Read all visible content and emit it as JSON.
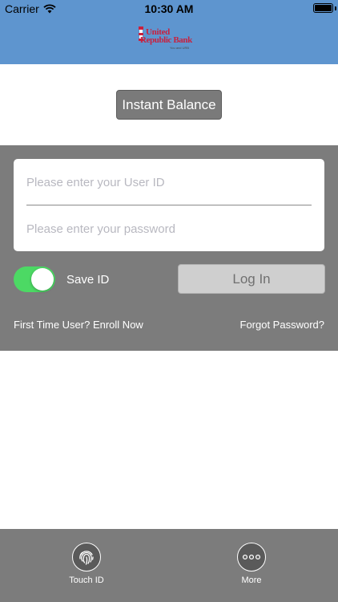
{
  "status_bar": {
    "carrier": "Carrier",
    "time": "10:30 AM",
    "battery_level": 1.0
  },
  "header": {
    "logo": {
      "line1": "United",
      "line2": "Republic Bank",
      "tagline": "You and URB",
      "color": "#c8213f"
    },
    "background": "#5e95cf"
  },
  "instant_balance": {
    "label": "Instant Balance"
  },
  "login": {
    "user_id": {
      "value": "",
      "placeholder": "Please enter your User ID"
    },
    "password": {
      "value": "",
      "placeholder": "Please enter your password"
    },
    "save_id": {
      "label": "Save ID",
      "on": true,
      "on_color": "#4cd964"
    },
    "login_label": "Log In",
    "enroll_label": "First Time User? Enroll Now",
    "forgot_label": "Forgot Password?"
  },
  "tab_bar": {
    "items": [
      {
        "label": "Touch ID",
        "icon": "fingerprint-icon"
      },
      {
        "label": "More",
        "icon": "more-dots-icon"
      }
    ]
  }
}
